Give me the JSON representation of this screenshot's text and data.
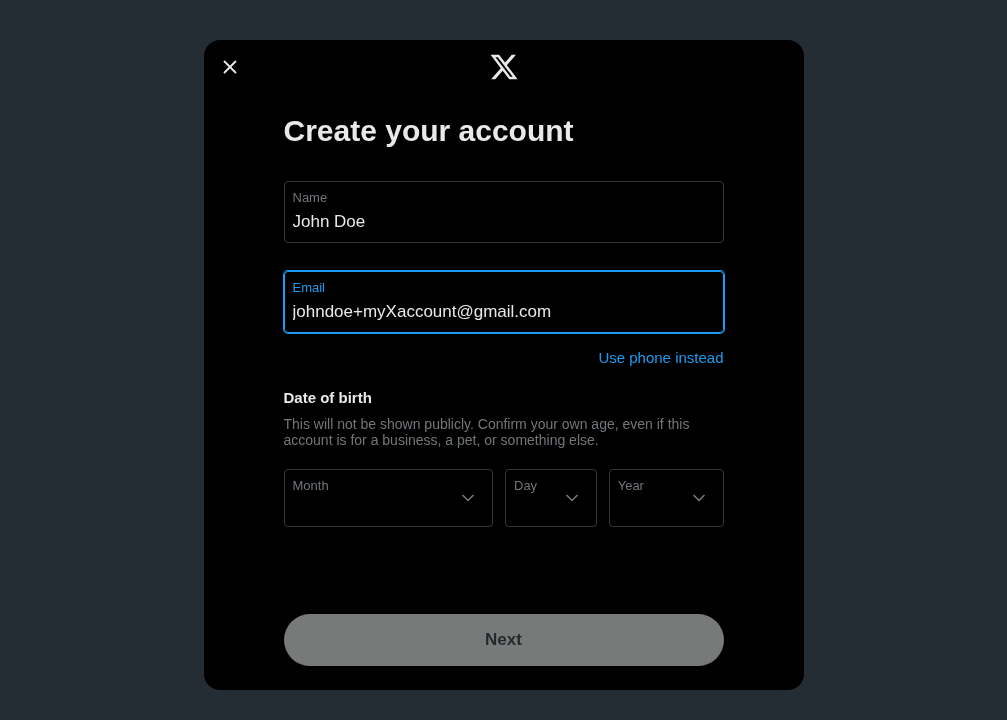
{
  "modal": {
    "title": "Create your account"
  },
  "fields": [
    {
      "label": "Name",
      "value": "John Doe",
      "focused": false
    },
    {
      "label": "Email",
      "value": "johndoe+myXaccount@gmail.com",
      "focused": true
    }
  ],
  "switch_link": "Use phone instead",
  "date_of_birth": {
    "title": "Date of birth",
    "description": "This will not be shown publicly. Confirm your own age, even if this account is for a business, a pet, or something else.",
    "selects": [
      {
        "label": "Month"
      },
      {
        "label": "Day"
      },
      {
        "label": "Year"
      }
    ]
  },
  "next_button": {
    "label": "Next",
    "disabled": true
  }
}
